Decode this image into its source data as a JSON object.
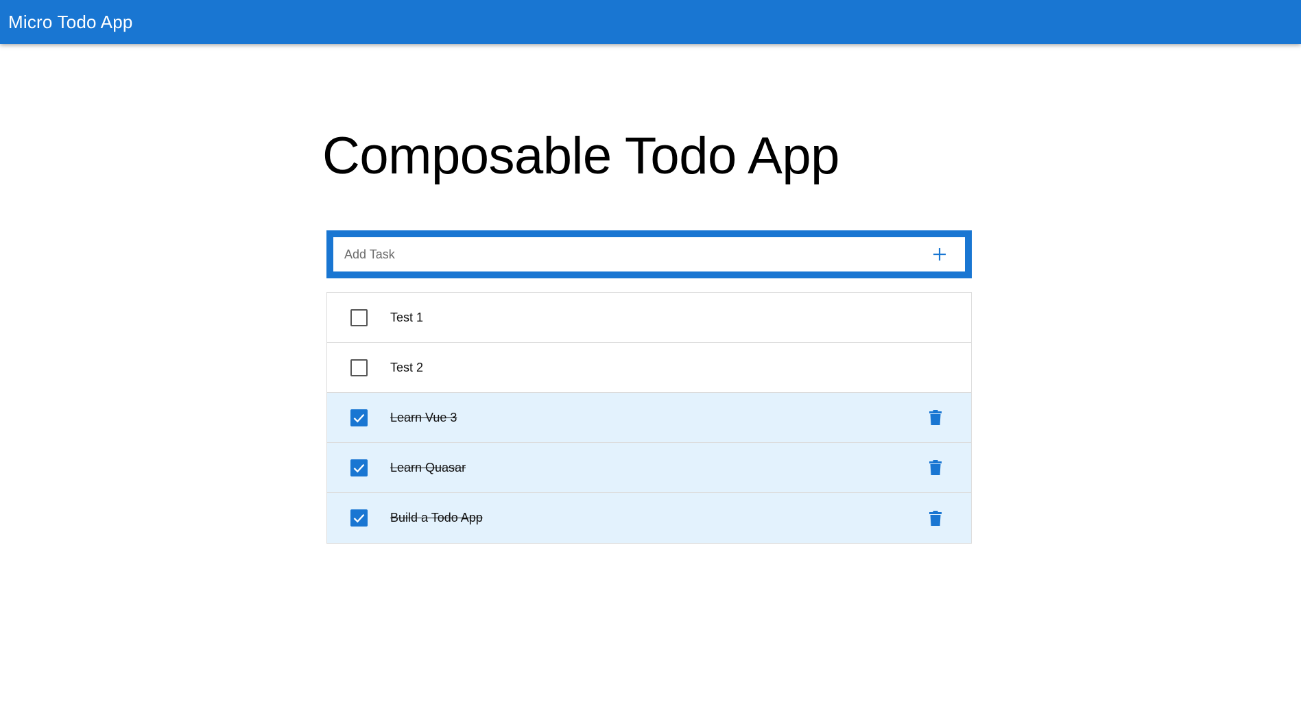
{
  "header": {
    "title": "Micro Todo App"
  },
  "page": {
    "title": "Composable Todo App"
  },
  "add_task": {
    "placeholder": "Add Task",
    "value": "",
    "button_icon": "plus-icon"
  },
  "tasks": [
    {
      "label": "Test 1",
      "done": false
    },
    {
      "label": "Test 2",
      "done": false
    },
    {
      "label": "Learn Vue 3",
      "done": true,
      "action_icon": "trash-icon"
    },
    {
      "label": "Learn Quasar",
      "done": true,
      "action_icon": "trash-icon"
    },
    {
      "label": "Build a Todo App",
      "done": true,
      "action_icon": "trash-icon"
    }
  ],
  "colors": {
    "primary": "#1976d2",
    "done_row_bg": "#e3f2fd"
  }
}
